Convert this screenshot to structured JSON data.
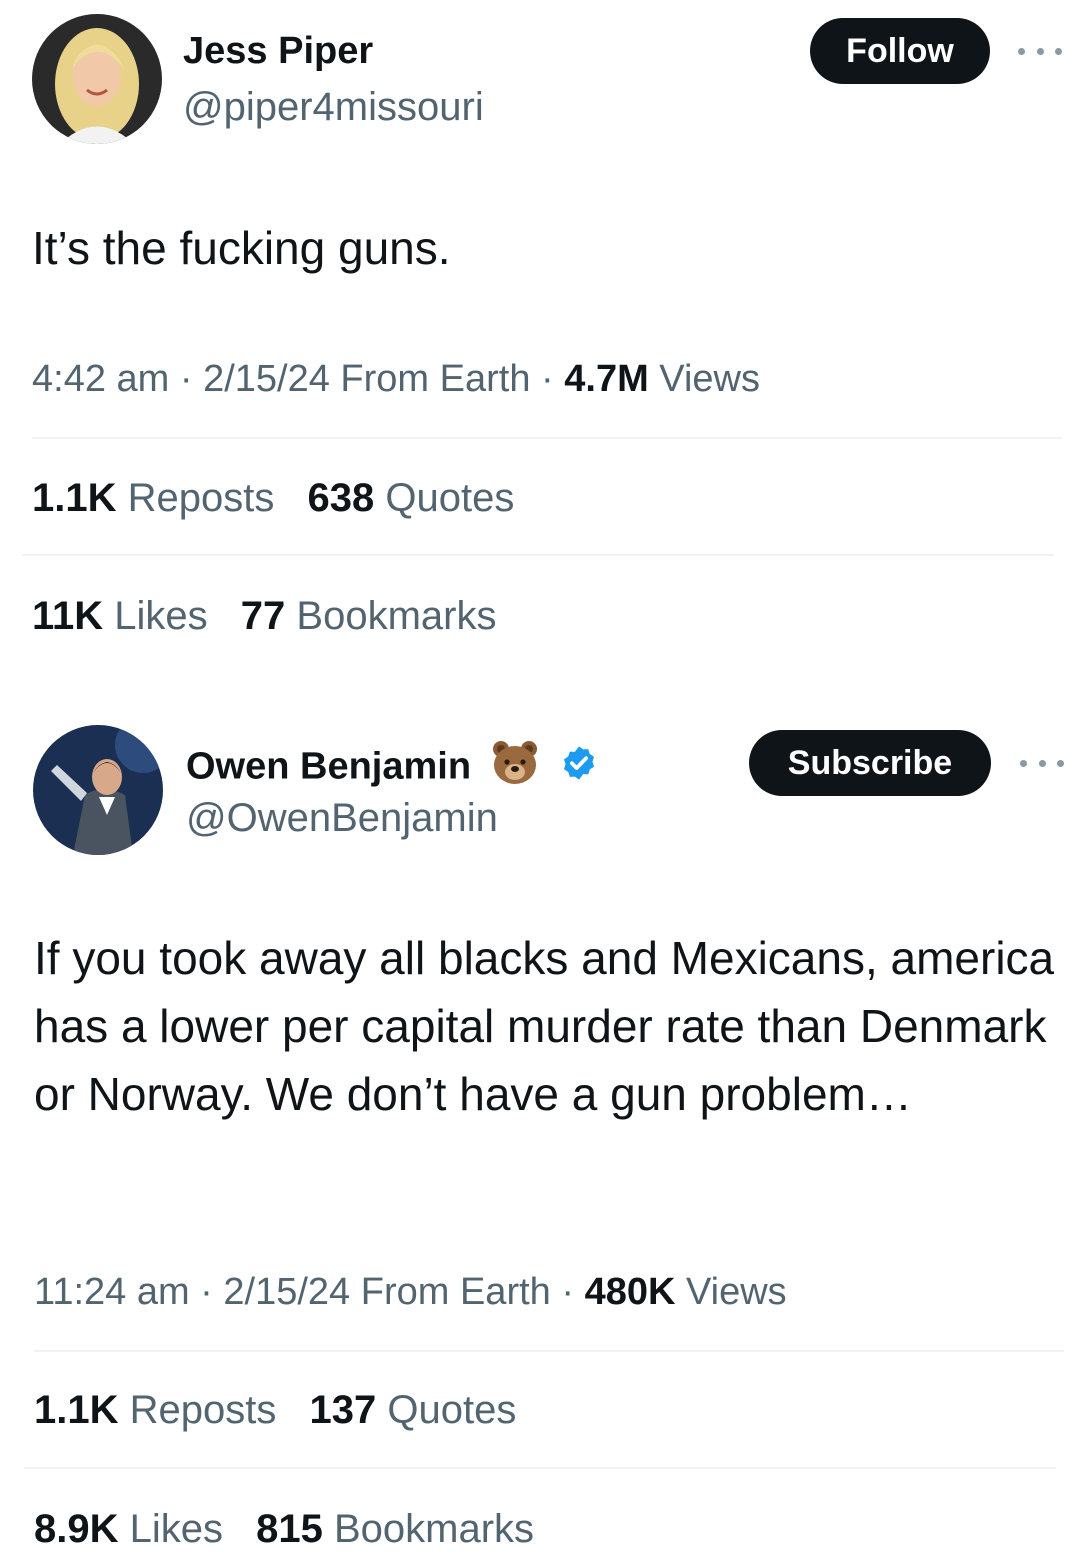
{
  "tweets": [
    {
      "author": {
        "name": "Jess Piper",
        "handle": "@piper4missouri"
      },
      "action_button": "Follow",
      "text": "It’s the fucking guns.",
      "meta": {
        "time": "4:42 am",
        "sep1": " · ",
        "date": "2/15/24 From Earth",
        "sep2": " · ",
        "views_count": "4.7M",
        "views_label": " Views"
      },
      "stats_row1": [
        {
          "count": "1.1K",
          "label": " Reposts"
        },
        {
          "count": "638",
          "label": " Quotes"
        }
      ],
      "stats_row2": [
        {
          "count": "11K",
          "label": " Likes"
        },
        {
          "count": "77",
          "label": " Bookmarks"
        }
      ]
    },
    {
      "author": {
        "name": "Owen Benjamin",
        "handle": "@OwenBenjamin",
        "emoji": "bear-emoji-icon",
        "verified": true
      },
      "action_button": "Subscribe",
      "text": "If you took away all blacks and Mexicans, america has a lower per capital murder rate than Denmark or Norway. We don’t have a gun problem…",
      "meta": {
        "time": "11:24 am",
        "sep1": " · ",
        "date": "2/15/24 From Earth",
        "sep2": " · ",
        "views_count": "480K",
        "views_label": " Views"
      },
      "stats_row1": [
        {
          "count": "1.1K",
          "label": " Reposts"
        },
        {
          "count": "137",
          "label": " Quotes"
        }
      ],
      "stats_row2": [
        {
          "count": "8.9K",
          "label": " Likes"
        },
        {
          "count": "815",
          "label": " Bookmarks"
        }
      ]
    }
  ],
  "colors": {
    "text": "#0f1419",
    "secondary": "#536471",
    "divider": "#eff3f4",
    "verified": "#1d9bf0"
  }
}
